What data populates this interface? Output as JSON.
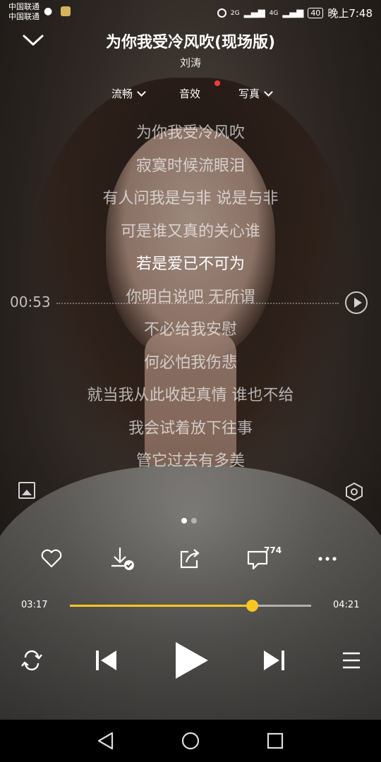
{
  "status_bar": {
    "carrier_1": "中国联通",
    "carrier_2": "中国联通",
    "network_1": "2G",
    "network_2": "4G",
    "battery": "40",
    "time": "晚上7:48"
  },
  "header": {
    "title": "为你我受冷风吹(现场版)",
    "artist": "刘涛"
  },
  "options": {
    "quality": "流畅",
    "effects": "音效",
    "photo": "写真"
  },
  "lyrics": [
    "为你我受冷风吹",
    "寂寞时候流眼泪",
    "有人问我是与非 说是与非",
    "可是谁又真的关心谁",
    "若是爱已不可为",
    "你明白说吧 无所谓",
    "不必给我安慰",
    "何必怕我伤悲",
    "就当我从此收起真情 谁也不给",
    "我会试着放下往事",
    "管它过去有多美"
  ],
  "active_lyric_index": 4,
  "seek_time": "00:53",
  "page_dots": {
    "count": 2,
    "active": 0
  },
  "comment_count": "774",
  "progress": {
    "current": "03:17",
    "duration": "04:21",
    "fraction": 0.755
  },
  "colors": {
    "accent": "#f6c623",
    "badge": "#ff3b3b"
  }
}
